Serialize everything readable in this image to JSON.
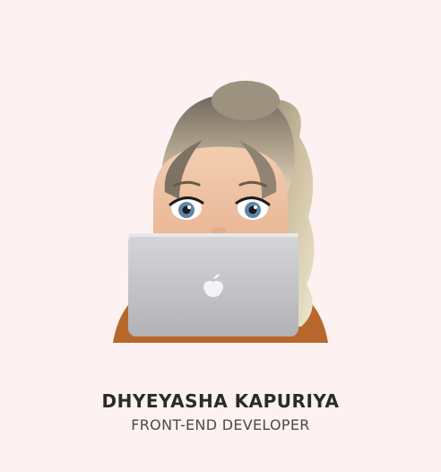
{
  "profile": {
    "avatar_icon": "memoji-laptop-avatar-icon",
    "name": "DHYEYASHA KAPURIYA",
    "role": "FRONT-END DEVELOPER"
  },
  "colors": {
    "background": "#fdf1f1",
    "name_text": "#2b2b2b",
    "role_text": "#4a4a4a",
    "laptop_silver": "#c4c4c8"
  }
}
